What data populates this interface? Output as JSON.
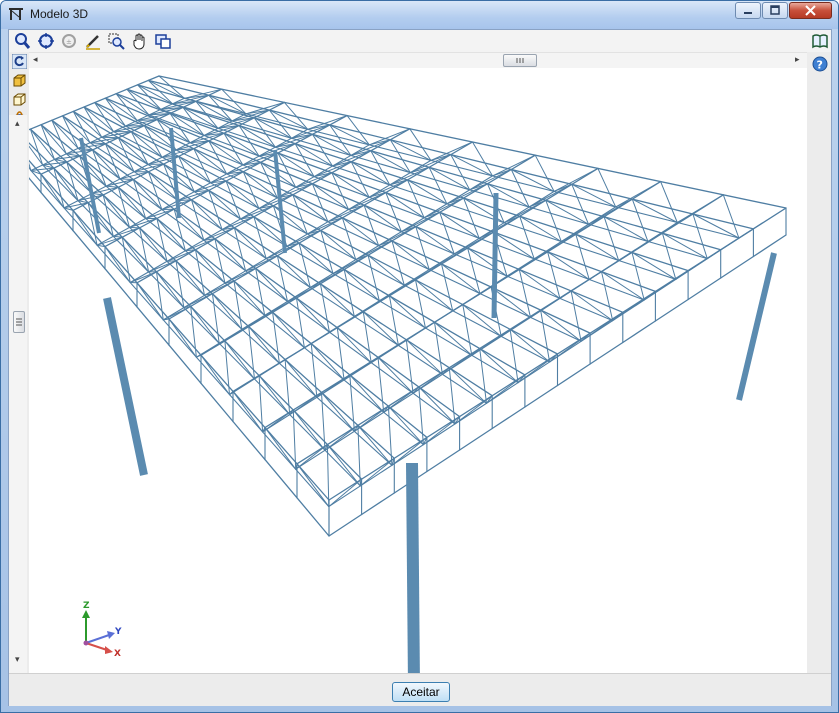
{
  "window": {
    "title": "Modelo 3D"
  },
  "toolbar": {
    "tools": [
      "zoom-icon",
      "zoom-extents-icon",
      "zoom-previous-icon",
      "pencil-icon",
      "zoom-window-icon",
      "pan-hand-icon",
      "copy-view-icon"
    ],
    "right_tool": "book-icon"
  },
  "left_tools": [
    "rotate-icon",
    "cube-icon",
    "wire-cube-icon",
    "orbit-icon"
  ],
  "axes": {
    "x": "X",
    "y": "Y",
    "z": "Z"
  },
  "buttons": {
    "ok_label": "Aceitar"
  },
  "colors": {
    "structure": "#4f7ea3",
    "column": "#5b8bb0",
    "title_bar": "#b3cdef",
    "close": "#c8503b"
  }
}
